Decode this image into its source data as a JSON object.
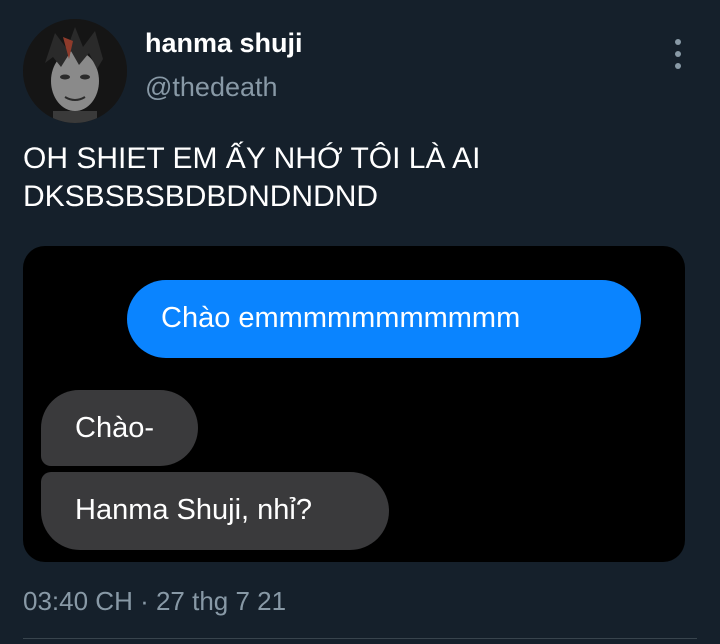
{
  "author": {
    "display_name": "hanma shuji",
    "handle": "@thedeath"
  },
  "tweet": {
    "text_lines": [
      "OH SHIET EM ẤY NHỚ TÔI LÀ AI",
      "DKSBSBSBDBDNDNDND"
    ],
    "timestamp": "03:40 CH · 27 thg 7 21"
  },
  "media": {
    "messages": [
      {
        "direction": "outgoing",
        "text": "Chào emmmmmmmmmmm",
        "color": "#0a84ff"
      },
      {
        "direction": "incoming",
        "text": "Chào-",
        "color": "#3a3a3c"
      },
      {
        "direction": "incoming",
        "text": "Hanma Shuji, nhỉ?",
        "color": "#3a3a3c"
      }
    ]
  },
  "icons": {
    "more": "more-vertical-icon"
  },
  "colors": {
    "background": "#15202b",
    "secondary_text": "#8899a6",
    "outgoing_bubble": "#0a84ff",
    "incoming_bubble": "#3a3a3c"
  }
}
